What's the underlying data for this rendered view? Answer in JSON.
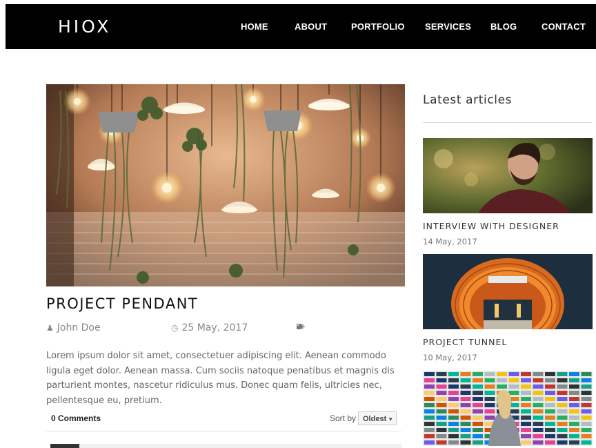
{
  "header": {
    "logo": "HIOX",
    "nav": [
      "HOME",
      "ABOUT",
      "PORTFOLIO",
      "SERVICES",
      "BLOG",
      "CONTACT"
    ]
  },
  "post": {
    "title": "PROJECT PENDANT",
    "author": "John Doe",
    "date": "25 May, 2017",
    "excerpt": "Lorem ipsum dolor sit amet, consectetuer adipiscing elit. Aenean commodo ligula eget dolor. Aenean massa. Cum sociis natoque penatibus et magnis dis parturient montes, nascetur ridiculus mus. Donec quam felis, ultricies nec, pellentesque eu, pretium."
  },
  "icons": {
    "author": "user-icon",
    "date": "clock-icon",
    "tags": "tags-icon",
    "sort": "caret-down-icon"
  },
  "comments": {
    "count": "0 Comments",
    "sort_label": "Sort by",
    "sort_value": "Oldest"
  },
  "sidebar": {
    "title": "Latest articles",
    "articles": [
      {
        "title": "INTERVIEW WITH DESIGNER",
        "date": "14 May, 2017"
      },
      {
        "title": "PROJECT TUNNEL",
        "date": "10 May, 2017"
      }
    ]
  },
  "colors": {
    "nav_bg": "#000000",
    "nav_text": "#ffffff",
    "text_dark": "#111111",
    "text_muted": "#888888"
  }
}
